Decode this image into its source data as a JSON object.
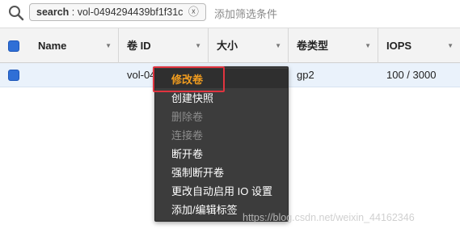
{
  "search": {
    "chip_key": "search",
    "chip_value": " : vol-0494294439bf1f31c",
    "chip_close": "ⓧ",
    "placeholder": "添加筛选条件"
  },
  "table": {
    "columns": [
      "Name",
      "卷 ID",
      "大小",
      "卷类型",
      "IOPS"
    ],
    "rows": [
      {
        "name": "",
        "volume_id": "vol-04",
        "size": "",
        "type": "gp2",
        "iops": "100 / 3000"
      }
    ]
  },
  "context_menu": {
    "items": [
      {
        "label": "修改卷",
        "state": "highlighted"
      },
      {
        "label": "创建快照",
        "state": "enabled"
      },
      {
        "label": "删除卷",
        "state": "disabled"
      },
      {
        "label": "连接卷",
        "state": "disabled"
      },
      {
        "label": "断开卷",
        "state": "enabled"
      },
      {
        "label": "强制断开卷",
        "state": "enabled"
      },
      {
        "label": "更改自动启用 IO 设置",
        "state": "enabled"
      },
      {
        "label": "添加/编辑标签",
        "state": "enabled"
      }
    ]
  },
  "watermark": "https://blog.csdn.net/weixin_44162346",
  "colors": {
    "menu_bg": "#3c3c3c",
    "highlight_text": "#f29d1f",
    "annotation_box": "#e0343f",
    "checkbox": "#2f6fd6",
    "selected_row": "#eaf2fb"
  }
}
